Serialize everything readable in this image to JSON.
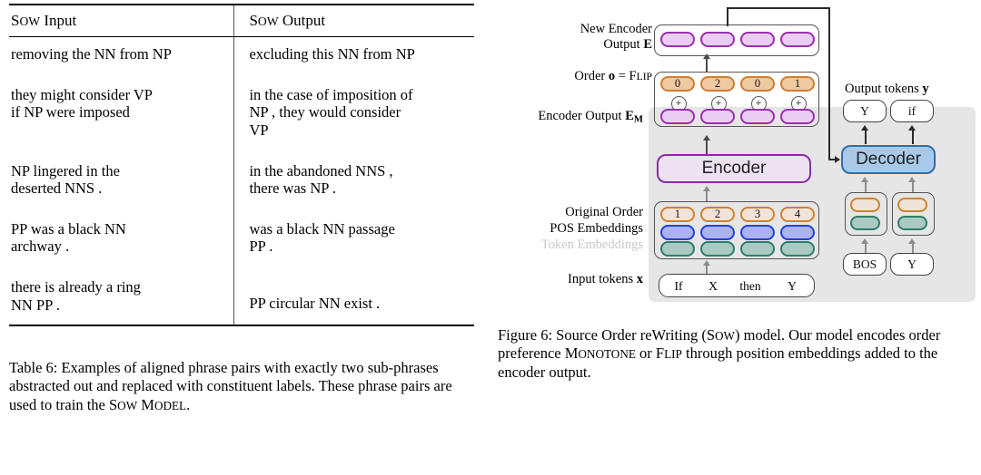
{
  "table": {
    "headers": {
      "left": "Sow Input",
      "right": "Sow Output"
    },
    "rows": [
      {
        "input": "removing the NN from NP",
        "output": "excluding this NN from NP"
      },
      {
        "input": "they might consider VP\nif NP were imposed",
        "output": "in the case of imposition of\nNP , they would consider\nVP"
      },
      {
        "input": "NP lingered in the\ndeserted NNS .",
        "output": "in the abandoned NNS ,\nthere was NP ."
      },
      {
        "input": "PP was a black NN\narchway .",
        "output": "was a black NN passage\nPP ."
      },
      {
        "input": "there is already a ring\nNN PP .",
        "output": "PP circular NN exist ."
      }
    ],
    "caption": "Table 6: Examples of aligned phrase pairs with exactly two sub-phrases abstracted out and replaced with constituent labels. These phrase pairs are used to train the Sow Model."
  },
  "figure": {
    "caption": "Figure 6: Source Order reWriting (Sow) model. Our model encodes order preference Monotone or Flip through position embeddings added to the encoder output.",
    "labels": {
      "new_encoder_output": "New Encoder\nOutput E",
      "new_encoder_output_line1": "New Encoder",
      "new_encoder_output_line2": "Output",
      "new_encoder_output_sym": "E",
      "order_prefix": "Order",
      "order_sym": "o",
      "order_eq": "=",
      "order_value": "Flip",
      "encoder_output": "Encoder Output",
      "encoder_output_sym": "E",
      "encoder_output_sub": "M",
      "original_order": "Original Order",
      "pos_embeddings": "POS Embeddings",
      "token_embeddings": "Token Embeddings",
      "input_tokens": "Input tokens",
      "input_tokens_sym": "x",
      "output_tokens": "Output tokens",
      "output_tokens_sym": "y"
    },
    "modules": {
      "encoder": "Encoder",
      "decoder": "Decoder"
    },
    "new_encoder_output_cells": [
      "",
      "",
      "",
      ""
    ],
    "order_values": [
      "0",
      "2",
      "0",
      "1"
    ],
    "plus_signs": [
      "+",
      "+",
      "+",
      "+"
    ],
    "encoder_output_cells": [
      "",
      "",
      "",
      ""
    ],
    "original_order_values": [
      "1",
      "2",
      "3",
      "4"
    ],
    "input_tokens": [
      "If",
      "X",
      "then",
      "Y"
    ],
    "decoder_inputs": [
      "BOS",
      "Y"
    ],
    "output_tokens": [
      "Y",
      "if"
    ],
    "colors": {
      "purple_fill": "#e9cdf3",
      "purple_border": "#9a2fb0",
      "orange_fill": "#efc9a0",
      "orange_border": "#cf7f32",
      "orange_hollow_fill": "#f0e3d8",
      "blue_fill": "#aab2f0",
      "blue_border": "#2340d6",
      "teal_fill": "#a9c9c1",
      "teal_border": "#2d7d6d",
      "encoder_fill": "#ece2f2",
      "encoder_border": "#8e2aa6",
      "decoder_fill": "#a9c9e8",
      "decoder_border": "#2f6fa8",
      "panel_bg": "#e6e6e6",
      "muted_label": "#c9c9c9"
    }
  }
}
